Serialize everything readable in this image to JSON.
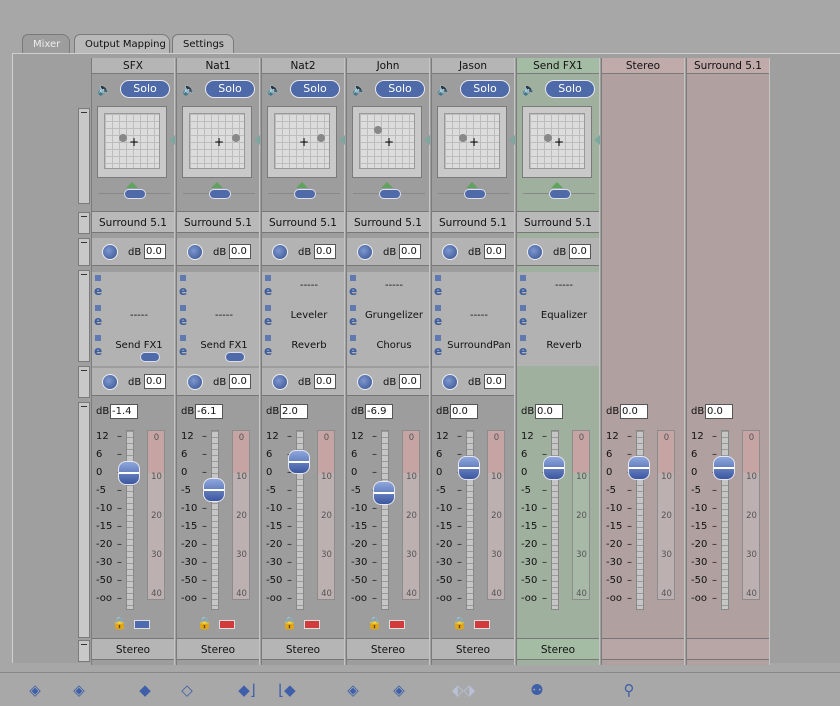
{
  "tabs": [
    {
      "label": "Mixer",
      "active": true
    },
    {
      "label": "Output Mapping",
      "active": false
    },
    {
      "label": "Settings",
      "active": false
    }
  ],
  "strips": [
    {
      "name": "SFX",
      "solo": "Solo",
      "output": "Surround 5.1",
      "gain1": "0.0",
      "inserts": [
        "",
        "-----",
        "Send FX1"
      ],
      "gain2": "0.0",
      "fader_db": "-1.4",
      "color": "#4f6bb0",
      "fader_pos": "-1.4",
      "bus": "Stereo"
    },
    {
      "name": "Nat1",
      "solo": "Solo",
      "output": "Surround 5.1",
      "gain1": "0.0",
      "inserts": [
        "",
        "-----",
        "Send FX1"
      ],
      "gain2": "0.0",
      "fader_db": "-6.1",
      "color": "#d23b3b",
      "fader_pos": "-6.1",
      "bus": "Stereo"
    },
    {
      "name": "Nat2",
      "solo": "Solo",
      "output": "Surround 5.1",
      "gain1": "0.0",
      "inserts": [
        "-----",
        "Leveler",
        "Reverb"
      ],
      "gain2": "0.0",
      "fader_db": "2.0",
      "color": "#d23b3b",
      "fader_pos": "2.0",
      "bus": "Stereo"
    },
    {
      "name": "John",
      "solo": "Solo",
      "output": "Surround 5.1",
      "gain1": "0.0",
      "inserts": [
        "-----",
        "Grungelizer",
        "Chorus"
      ],
      "gain2": "0.0",
      "fader_db": "-6.9",
      "color": "#d23b3b",
      "fader_pos": "-6.9",
      "bus": "Stereo"
    },
    {
      "name": "Jason",
      "solo": "Solo",
      "output": "Surround 5.1",
      "gain1": "0.0",
      "inserts": [
        "",
        "-----",
        "SurroundPan"
      ],
      "gain2": "0.0",
      "fader_db": "0.0",
      "color": "#d23b3b",
      "fader_pos": "0.0",
      "bus": "Stereo"
    },
    {
      "name": "Send FX1",
      "solo": "Solo",
      "output": "Surround 5.1",
      "gain1": "0.0",
      "inserts": [
        "-----",
        "Equalizer",
        "Reverb"
      ],
      "gain2": "",
      "fader_db": "0.0",
      "color": "",
      "fader_pos": "0.0",
      "bus": "Stereo"
    },
    {
      "name": "Stereo",
      "solo": "",
      "output": "",
      "gain1": "",
      "inserts": [
        "",
        "",
        ""
      ],
      "gain2": "",
      "fader_db": "0.0",
      "color": "",
      "fader_pos": "0.0",
      "bus": ""
    },
    {
      "name": "Surround 5.1",
      "solo": "",
      "output": "",
      "gain1": "",
      "inserts": [
        "",
        "",
        ""
      ],
      "gain2": "",
      "fader_db": "0.0",
      "color": "",
      "fader_pos": "0.0",
      "bus": ""
    }
  ],
  "scale_labels": [
    "12",
    "6",
    "0",
    "-5",
    "-10",
    "-15",
    "-20",
    "-30",
    "-50",
    "-oo"
  ],
  "meter_labels": [
    "0",
    "10",
    "20",
    "30",
    "40"
  ],
  "db_label": "dB",
  "toolbar": {
    "icons": [
      "insert-left-icon",
      "insert-right-icon",
      "diamond-icon",
      "diamond-outline-icon",
      "diamond-enter-icon",
      "diamond-exit-icon",
      "arrow-left-icon",
      "arrow-right-icon",
      "split-icon",
      "joystick-icon",
      "wand-icon"
    ]
  }
}
